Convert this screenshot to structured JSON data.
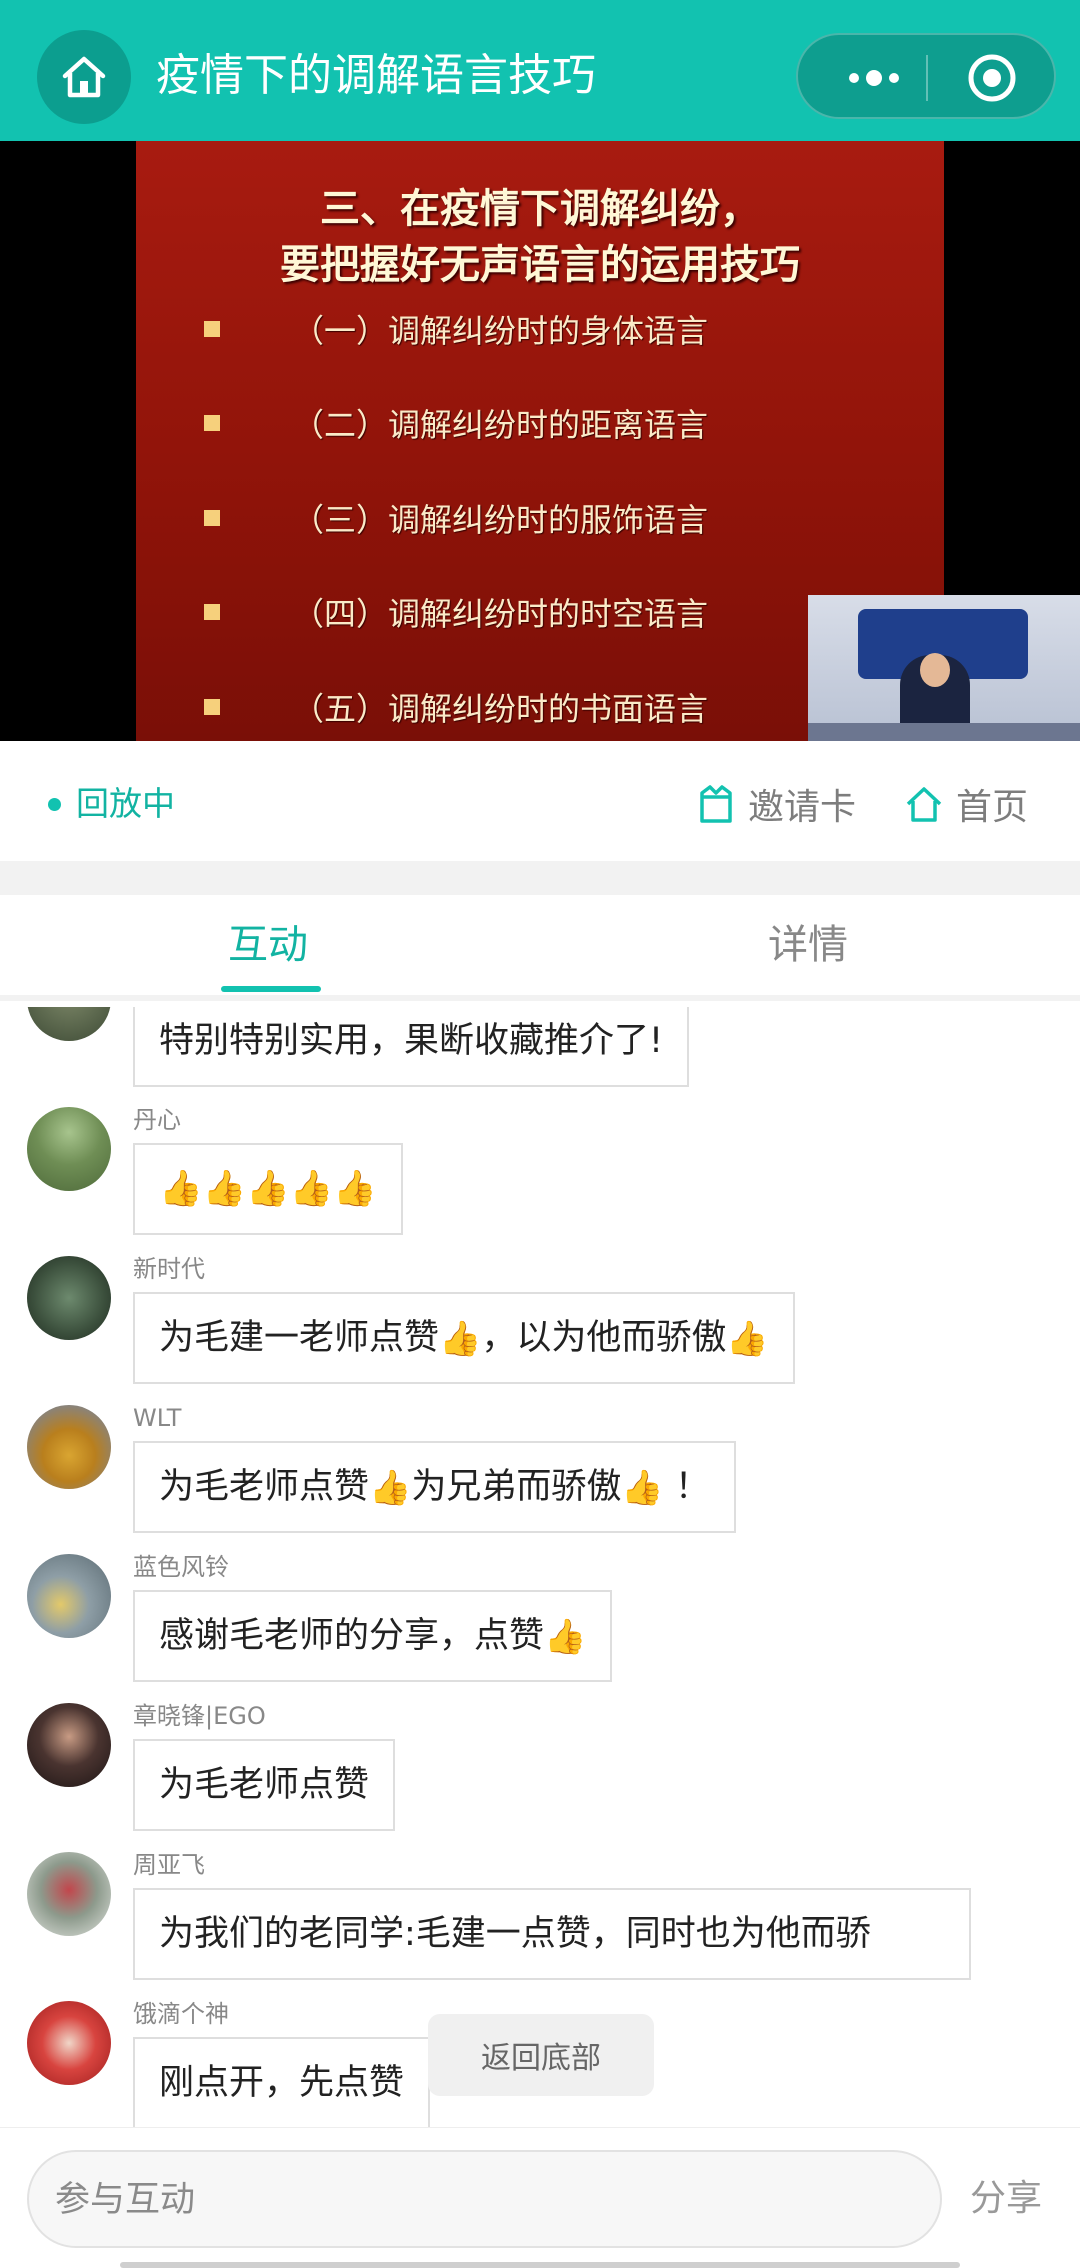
{
  "header": {
    "title": "疫情下的调解语言技巧",
    "bg_color": "#12c2b0"
  },
  "video": {
    "slide_title_line1": "三、在疫情下调解纠纷，",
    "slide_title_line2": "要把握好无声语言的运用技巧",
    "slide_items": [
      "（一）调解纠纷时的身体语言",
      "（二）调解纠纷时的距离语言",
      "（三）调解纠纷时的服饰语言",
      "（四）调解纠纷时的时空语言",
      "（五）调解纠纷时的书面语言"
    ]
  },
  "status": {
    "replay_label": "回放中",
    "invite_label": "邀请卡",
    "home_label": "首页"
  },
  "tabs": {
    "interact": "互动",
    "detail": "详情",
    "active": "互动"
  },
  "messages": [
    {
      "nick": "",
      "text": "特别特别实用，果断收藏推介了!"
    },
    {
      "nick": "丹心",
      "text": "👍👍👍👍👍"
    },
    {
      "nick": "新时代",
      "text_a": "为毛建一老师点赞",
      "text_b": "，以为他而骄傲"
    },
    {
      "nick": "WLT",
      "text_a": "为毛老师点赞",
      "text_b": "为兄弟而骄傲",
      "text_c": " ！"
    },
    {
      "nick": "蓝色风铃",
      "text_a": "感谢毛老师的分享，点赞"
    },
    {
      "nick": "章晓锋|EGO",
      "text": "为毛老师点赞"
    },
    {
      "nick": "周亚飞",
      "text": "为我们的老同学:毛建一点赞，同时也为他而骄"
    },
    {
      "nick": "饿滴个神",
      "text": "刚点开，先点赞"
    }
  ],
  "thumbs_emoji": "👍",
  "back_to_bottom": "返回底部",
  "input": {
    "placeholder": "参与互动",
    "share_label": "分享"
  }
}
